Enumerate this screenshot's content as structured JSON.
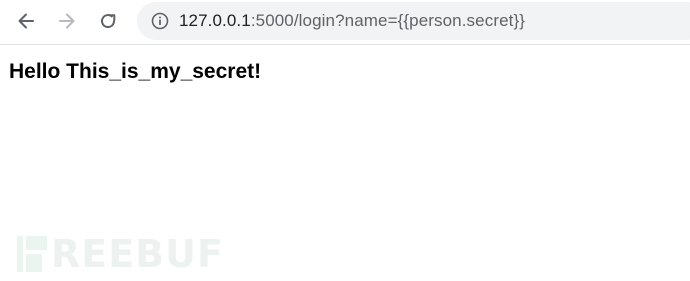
{
  "toolbar": {
    "url_host": "127.0.0.1",
    "url_rest": ":5000/login?name={{person.secret}}"
  },
  "page": {
    "greeting": "Hello This_is_my_secret!"
  },
  "watermark": {
    "text": "REEBUF"
  },
  "colors": {
    "toolbar_bg": "#ffffff",
    "omnibox_bg": "#f1f3f4",
    "icon_color": "#5f6368",
    "icon_disabled": "#b8babd",
    "page_text": "#000000",
    "watermark": "#d9ede3"
  },
  "icons": {
    "back": "arrow-left-icon",
    "forward": "arrow-right-icon",
    "reload": "reload-icon",
    "info": "info-circle-icon"
  }
}
